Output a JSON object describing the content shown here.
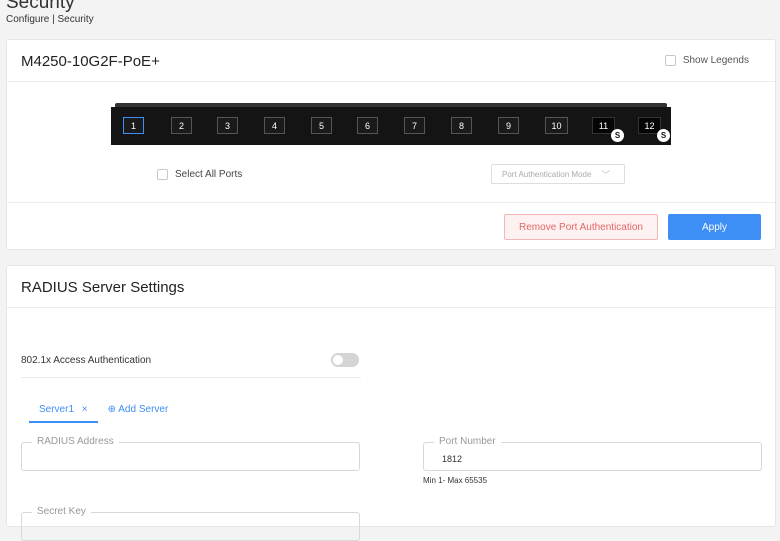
{
  "page": {
    "title": "Security",
    "breadcrumb": "Configure | Security"
  },
  "switch_panel": {
    "model": "M4250-10G2F-PoE+",
    "show_legends_label": "Show Legends",
    "ports": [
      "1",
      "2",
      "3",
      "4",
      "5",
      "6",
      "7",
      "8",
      "9",
      "10",
      "11",
      "12"
    ],
    "selected_port": "1",
    "sfp_badge": "S",
    "select_all_label": "Select All Ports",
    "auth_mode_placeholder": "Port Authentication Mode",
    "remove_button": "Remove Port Authentication",
    "apply_button": "Apply"
  },
  "radius": {
    "title": "RADIUS Server Settings",
    "access_auth_label": "802.1x Access Authentication",
    "access_auth_enabled": false,
    "tabs": [
      {
        "label": "Server1",
        "close": "×"
      }
    ],
    "add_server_icon": "⊕",
    "add_server_label": "Add Server",
    "address_label": "RADIUS Address",
    "address_value": "",
    "port_label": "Port Number",
    "port_value": "1812",
    "port_hint": "Min 1- Max 65535",
    "secret_label": "Secret Key"
  },
  "colors": {
    "accent": "#3d8ef5",
    "danger": "#e46767",
    "danger_bg": "#fdf1f1"
  }
}
